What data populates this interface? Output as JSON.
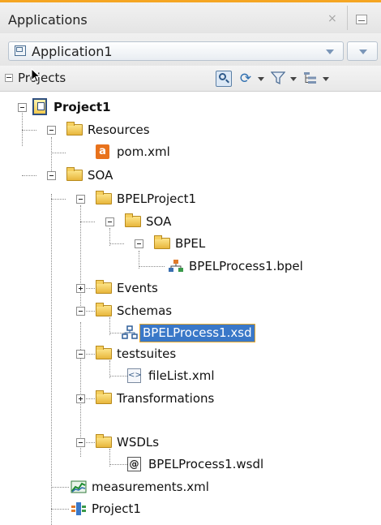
{
  "panel": {
    "title": "Applications",
    "close_symbol": "×"
  },
  "application": {
    "selected": "Application1",
    "icon": "application-icon"
  },
  "projects_header": {
    "label": "Projects",
    "collapse_symbol": "−",
    "toolbar_icons": [
      "search-icon",
      "sync-icon",
      "filter-icon",
      "structure-icon"
    ]
  },
  "tree": {
    "nodes": [
      {
        "label": "Project1",
        "icon": "project-icon",
        "expanded": true,
        "bold": true
      },
      {
        "label": "Resources",
        "icon": "folder-icon",
        "expanded": true
      },
      {
        "label": "pom.xml",
        "icon": "maven-xml-icon"
      },
      {
        "label": "SOA",
        "icon": "folder-icon",
        "expanded": true
      },
      {
        "label": "BPELProject1",
        "icon": "folder-icon",
        "expanded": true
      },
      {
        "label": "SOA",
        "icon": "folder-icon",
        "expanded": true
      },
      {
        "label": "BPEL",
        "icon": "folder-icon",
        "expanded": true
      },
      {
        "label": "BPELProcess1.bpel",
        "icon": "bpel-process-icon"
      },
      {
        "label": "Events",
        "icon": "folder-icon",
        "expanded": false
      },
      {
        "label": "Schemas",
        "icon": "folder-icon",
        "expanded": true
      },
      {
        "label": "BPELProcess1.xsd",
        "icon": "xsd-schema-icon",
        "selected": true
      },
      {
        "label": "testsuites",
        "icon": "folder-icon",
        "expanded": true
      },
      {
        "label": "fileList.xml",
        "icon": "xml-file-icon"
      },
      {
        "label": "Transformations",
        "icon": "folder-icon",
        "expanded": false
      },
      {
        "label": "WSDLs",
        "icon": "folder-icon",
        "expanded": true
      },
      {
        "label": "BPELProcess1.wsdl",
        "icon": "wsdl-icon"
      },
      {
        "label": "measurements.xml",
        "icon": "measurements-icon"
      },
      {
        "label": "Project1",
        "icon": "composite-icon"
      }
    ]
  },
  "colors": {
    "accent_line": "#f5a623",
    "selection": "#3a78c8",
    "selection_outline": "#e9a92d",
    "folder": "#f0c74a"
  }
}
